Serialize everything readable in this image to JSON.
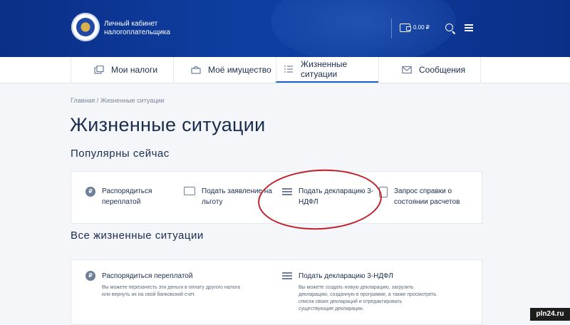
{
  "header": {
    "brand_line1": "Личный кабинет",
    "brand_line2": "налогоплательщика",
    "balance": "0.00 ₽"
  },
  "nav": {
    "tabs": [
      {
        "label": "Мои налоги",
        "icon": "taxes-icon"
      },
      {
        "label": "Моё имущество",
        "icon": "property-icon"
      },
      {
        "label": "Жизненные ситуации",
        "icon": "situations-icon"
      },
      {
        "label": "Сообщения",
        "icon": "envelope-icon"
      }
    ]
  },
  "breadcrumb": {
    "home": "Главная",
    "separator": "/",
    "current": "Жизненные ситуации"
  },
  "page": {
    "title": "Жизненные ситуации",
    "popular_heading": "Популярны сейчас",
    "all_heading": "Все жизненные ситуации"
  },
  "popular": [
    {
      "line1": "Распорядиться",
      "line2": "переплатой",
      "icon": "ruble-coin-icon"
    },
    {
      "line1": "Подать заявление на",
      "line2": "льготу",
      "icon": "application-icon"
    },
    {
      "line1": "Подать декларацию 3-",
      "line2": "НДФЛ",
      "icon": "declaration-icon"
    },
    {
      "line1": "Запрос справки о",
      "line2": "состоянии расчетов",
      "icon": "certificate-icon"
    }
  ],
  "all_situations": [
    {
      "title": "Распорядиться переплатой",
      "desc1": "Вы можете перезачесть эти деньги в оплату другого налога",
      "desc2": "или вернуть их на свой банковский счет.",
      "icon": "ruble-coin-icon"
    },
    {
      "title": "Подать декларацию 3-НДФЛ",
      "desc1": "Вы можете создать новую декларацию, загрузить",
      "desc2": "декларацию, созданную в программе, а также просмотреть",
      "desc3": "список своих деклараций и отредактировать",
      "desc4": "существующие декларации.",
      "icon": "declaration-icon"
    }
  ],
  "watermark": "pln24.ru",
  "colors": {
    "header": "#0f3fa3",
    "accent": "#1f5fc7",
    "annotation": "#c0222a"
  }
}
